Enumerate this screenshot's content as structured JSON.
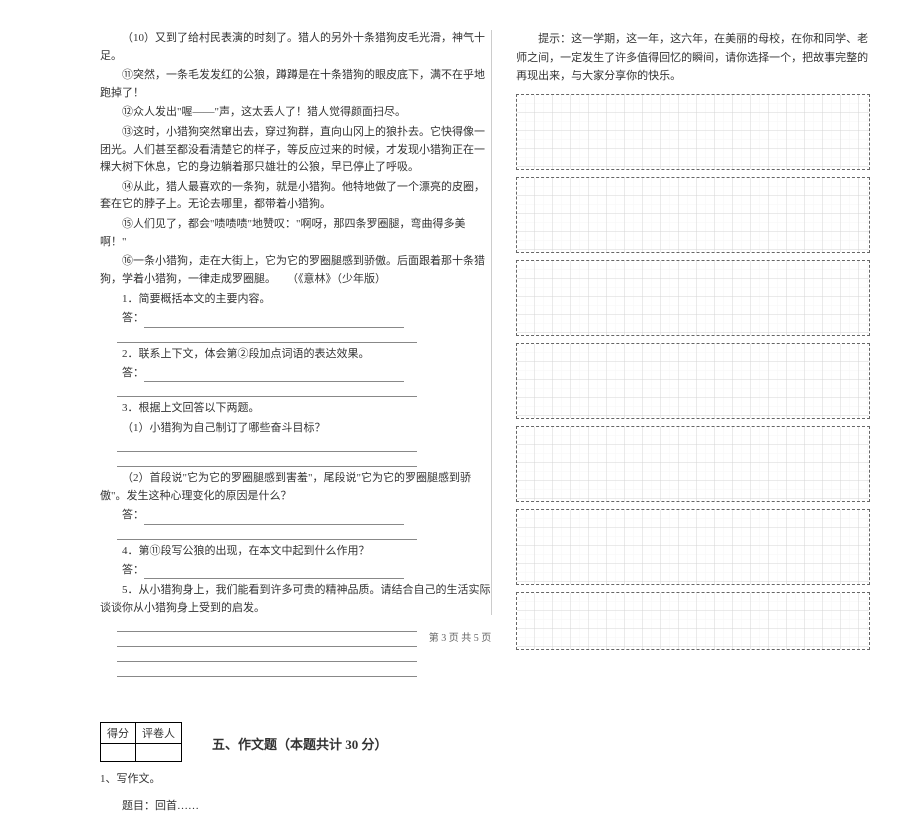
{
  "left": {
    "p10": "（10）又到了给村民表演的时刻了。猎人的另外十条猎狗皮毛光滑，神气十足。",
    "p11": "⑪突然，一条毛发发红的公狼，蹲蹲是在十条猎狗的眼皮底下，满不在乎地跑掉了！",
    "p12": "⑫众人发出\"喔——\"声，这太丢人了！猎人觉得颜面扫尽。",
    "p13": "⑬这时，小猎狗突然窜出去，穿过狗群，直向山冈上的狼扑去。它快得像一团光。人们甚至都没看清楚它的样子，等反应过来的时候，才发现小猎狗正在一棵大树下休息，它的身边躺着那只雄壮的公狼，早已停止了呼吸。",
    "p14": "⑭从此，猎人最喜欢的一条狗，就是小猎狗。他特地做了一个漂亮的皮圈，套在它的脖子上。无论去哪里，都带着小猎狗。",
    "p15": "⑮人们见了，都会\"啧啧啧\"地赞叹：\"啊呀，那四条罗圈腿，弯曲得多美啊！\"",
    "p16": "⑯一条小猎狗，走在大街上，它为它的罗圈腿感到骄傲。后面跟着那十条猎狗，学着小猎狗，一律走成罗圈腿。　　（《意林》（少年版）",
    "q1": "1．简要概括本文的主要内容。",
    "ans_label": "答：",
    "q2": "2．联系上下文，体会第②段加点词语的表达效果。",
    "q3": "3．根据上文回答以下两题。",
    "q3_1": "（1）小猎狗为自己制订了哪些奋斗目标？",
    "q3_2": "（2）首段说\"它为它的罗圈腿感到害羞\"，尾段说\"它为它的罗圈腿感到骄傲\"。发生这种心理变化的原因是什么？",
    "q4": "4．第⑪段写公狼的出现，在本文中起到什么作用？",
    "q5": "5．从小猎狗身上，我们能看到许多可贵的精神品质。请结合自己的生活实际谈谈你从小猎狗身上受到的启发。",
    "score_h1": "得分",
    "score_h2": "评卷人",
    "section5": "五、作文题（本题共计 30 分）",
    "essay_num": "1、写作文。",
    "essay_title": "题目：回首……"
  },
  "right": {
    "prompt": "提示：这一学期，这一年，这六年，在美丽的母校，在你和同学、老师之间，一定发生了许多值得回忆的瞬间，请你选择一个，把故事完整的再现出来，与大家分享你的快乐。"
  },
  "footer": "第 3 页 共 5 页"
}
